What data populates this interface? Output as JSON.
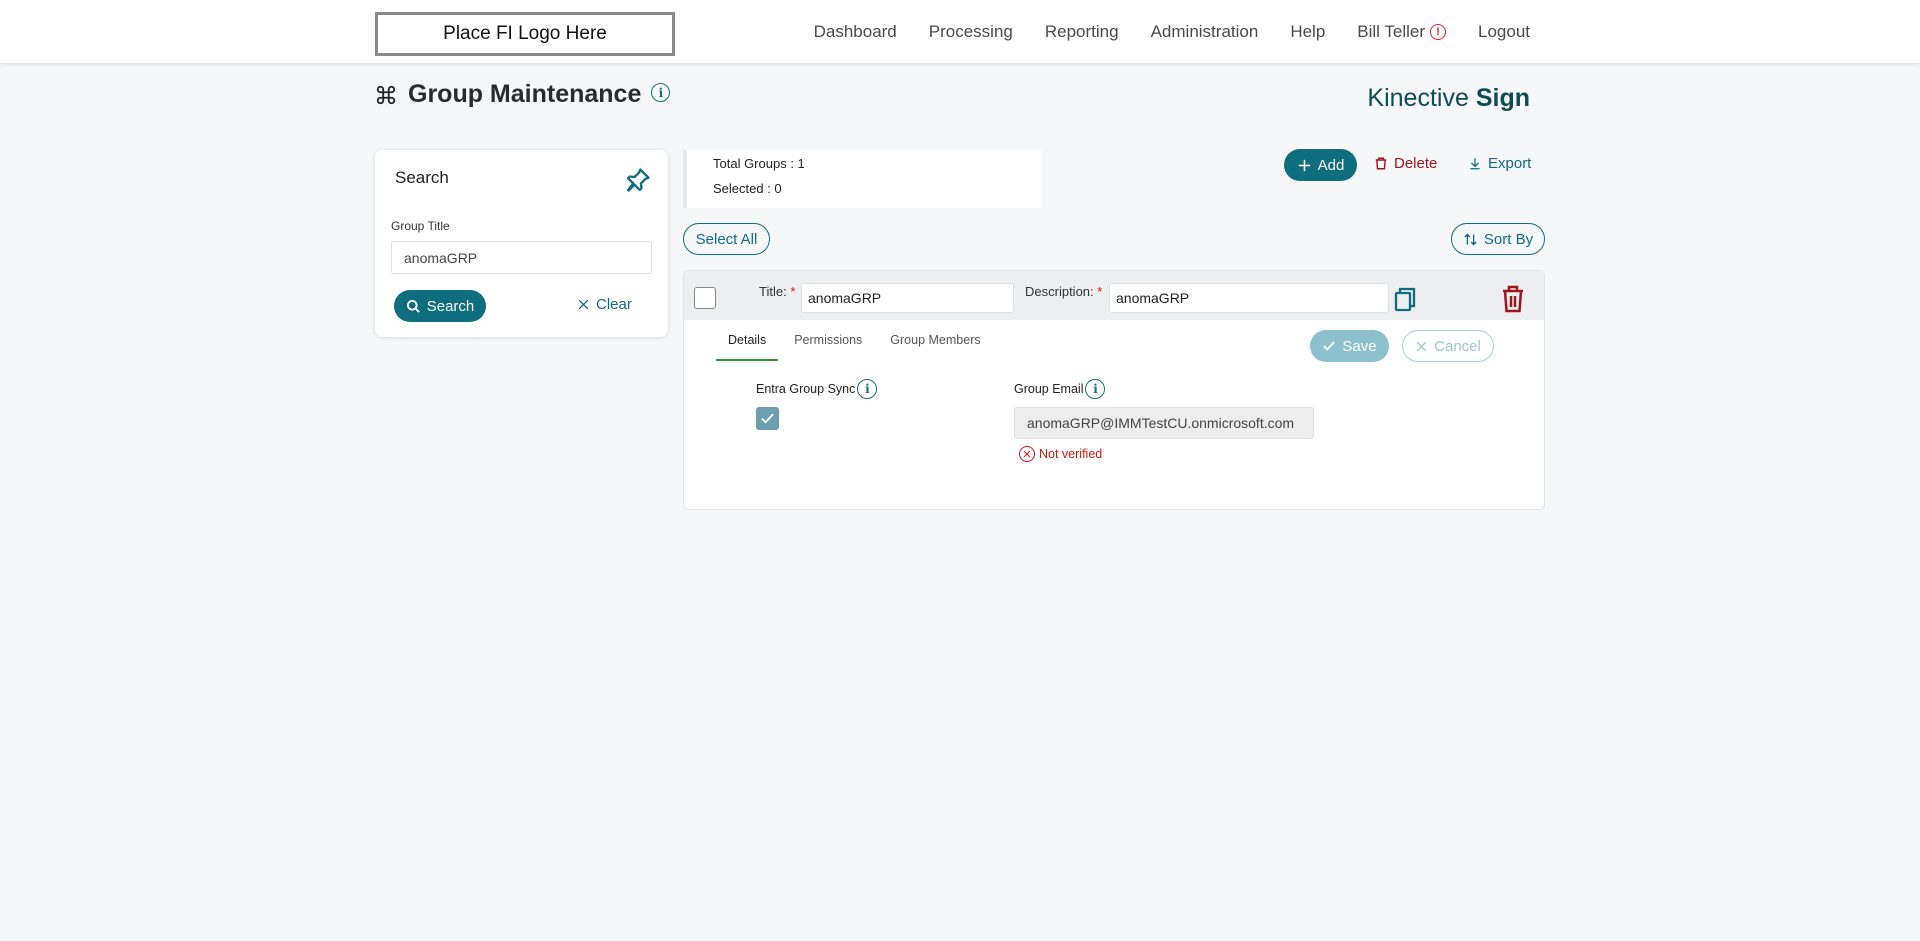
{
  "logo": {
    "text": "Place FI Logo Here"
  },
  "nav": {
    "items": [
      "Dashboard",
      "Processing",
      "Reporting",
      "Administration",
      "Help"
    ],
    "user": "Bill Teller",
    "logout": "Logout"
  },
  "page": {
    "title": "Group Maintenance",
    "brand_light": "Kinective",
    "brand_bold": "Sign"
  },
  "search": {
    "title": "Search",
    "field_label": "Group Title",
    "field_value": "anomaGRP",
    "search_label": "Search",
    "clear_label": "Clear"
  },
  "summary": {
    "total": "Total Groups : 1",
    "selected": "Selected : 0"
  },
  "actions": {
    "add": "Add",
    "delete": "Delete",
    "export": "Export",
    "select_all": "Select All",
    "sort_by": "Sort By"
  },
  "group": {
    "title_label": "Title:",
    "title_value": "anomaGRP",
    "description_label": "Description:",
    "description_value": "anomaGRP",
    "required_mark": "*",
    "tabs": [
      "Details",
      "Permissions",
      "Group Members"
    ],
    "save": "Save",
    "cancel": "Cancel",
    "sync_label": "Entra Group Sync",
    "sync_checked": true,
    "email_label": "Group Email",
    "email_value": "anomaGRP@IMMTestCU.onmicrosoft.com",
    "verify_status": "Not verified"
  },
  "colors": {
    "accent": "#0f6d80",
    "danger": "#a0141e",
    "tab_active": "#2f9a3c"
  }
}
